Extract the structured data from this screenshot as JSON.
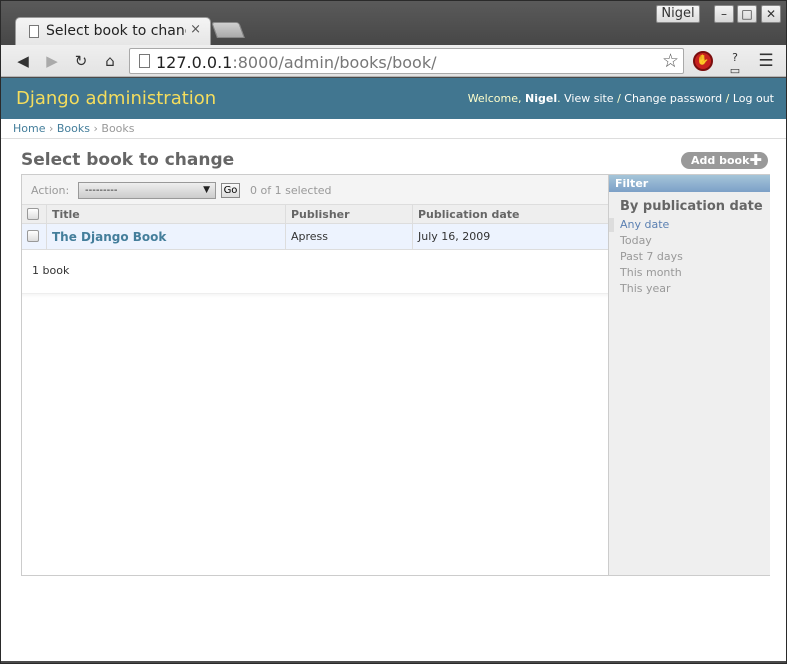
{
  "browser": {
    "tab_title": "Select book to change",
    "tab_close": "×",
    "profile_name": "Nigel",
    "window_buttons": {
      "minimize": "–",
      "maximize": "□",
      "close": "✕"
    },
    "url_host": "127.0.0.1",
    "url_rest": ":8000/admin/books/book/",
    "nav": {
      "back": "◀",
      "forward": "▶",
      "reload": "↻",
      "home": "⌂"
    }
  },
  "admin": {
    "brand": "Django administration",
    "user_tools": {
      "welcome": "Welcome,",
      "username": "Nigel",
      "view_site": "View site",
      "change_password": "Change password",
      "log_out": "Log out"
    },
    "breadcrumbs": [
      "Home",
      "Books",
      "Books"
    ],
    "page_title": "Select book to change",
    "add_button": "Add book",
    "actions": {
      "label": "Action:",
      "selected_value": "---------",
      "go": "Go",
      "counter": "0 of 1 selected"
    },
    "columns": [
      "Title",
      "Publisher",
      "Publication date"
    ],
    "rows": [
      {
        "title": "The Django Book",
        "publisher": "Apress",
        "publication_date": "July 16, 2009"
      }
    ],
    "paginator": "1 book",
    "filter": {
      "header": "Filter",
      "title": "By publication date",
      "options": [
        "Any date",
        "Today",
        "Past 7 days",
        "This month",
        "This year"
      ],
      "selected": "Any date"
    }
  },
  "colors": {
    "header_bg": "#417690",
    "brand_text": "#f5dd5d",
    "link": "#447e9b",
    "row_highlight": "#edf3fe"
  }
}
